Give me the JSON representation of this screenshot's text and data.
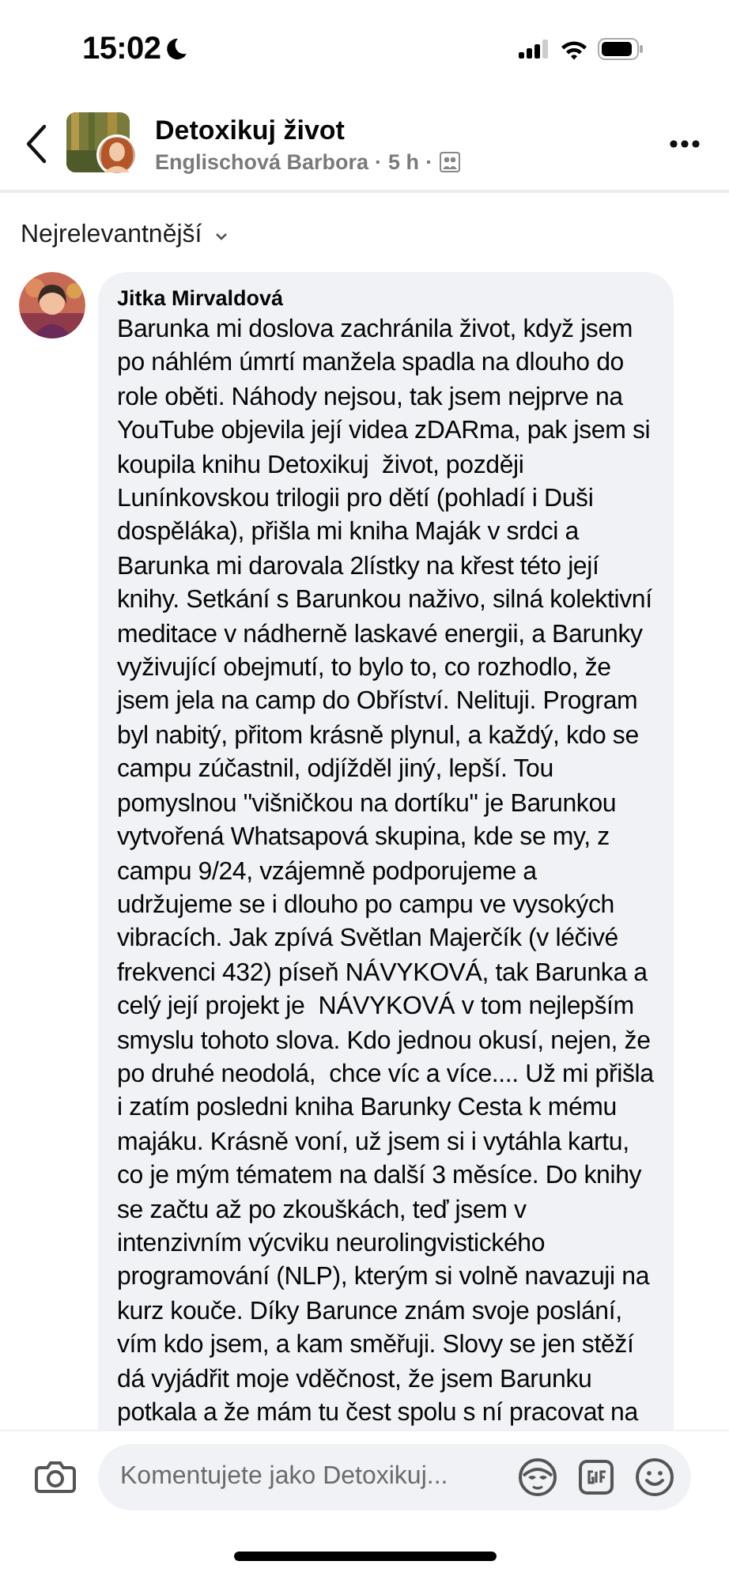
{
  "status_bar": {
    "time": "15:02"
  },
  "header": {
    "title": "Detoxikuj život",
    "author": "Englischová Barbora",
    "time": "5 h",
    "separator": "·"
  },
  "sort": {
    "label": "Nejrelevantnější"
  },
  "comment": {
    "author": "Jitka Mirvaldová",
    "lines": [
      "Barunka mi doslova zachránila život, když jsem",
      "po náhlém úmrtí manžela spadla na dlouho do",
      "role oběti. Náhody nejsou, tak jsem nejprve na",
      "YouTube objevila její videa zDARma, pak jsem si",
      "koupila knihu Detoxikuj  život, později",
      "Lunínkovskou trilogii pro dětí (pohladí i Duši",
      "dospěláka), přišla mi kniha Maják v srdci a",
      "Barunka mi darovala 2lístky na křest této její",
      "knihy. Setkání s Barunkou naživo, silná kolektivní",
      "meditace v nádherně laskavé energii, a Barunky",
      "vyživující obejmutí, to bylo to, co rozhodlo, že",
      "jsem jela na camp do Obříství. Nelituji. Program",
      "byl nabitý, přitom krásně plynul, a každý, kdo se",
      "campu zúčastnil, odjížděl jiný, lepší. Tou",
      "pomyslnou \"višničkou na dortíku\" je Barunkou",
      "vytvořená Whatsapová skupina, kde se my, z",
      "campu 9/24, vzájemně podporujeme a",
      "udržujeme se i dlouho po campu ve vysokých",
      "vibracích. Jak zpívá Světlan Majerčík (v léčivé",
      "frekvenci 432) píseň NÁVYKOVÁ, tak Barunka a",
      "celý její projekt je  NÁVYKOVÁ v tom nejlepším",
      "smyslu tohoto slova. Kdo jednou okusí, nejen, že",
      "po druhé neodolá,  chce víc a více.... Už mi přišla",
      "i zatím posledni kniha Barunky Cesta k mému",
      "majáku. Krásně voní, už jsem si i vytáhla kartu,",
      "co je mým tématem na další 3 měsíce. Do knihy",
      "se začtu až po zkouškách, teď jsem v",
      "intenzivním výcviku neurolingvistického",
      "programování (NLP), kterým si volně navazuji na",
      "kurz kouče. Díky Barunce znám svoje poslání,",
      "vím kdo jsem, a kam směřuji. Slovy se jen stěží",
      "dá vyjádřit moje vděčnost, že jsem Barunku",
      "potkala a že mám tu čest spolu s ní pracovat na"
    ]
  },
  "composer": {
    "placeholder": "Komentujete jako Detoxikuj..."
  }
}
